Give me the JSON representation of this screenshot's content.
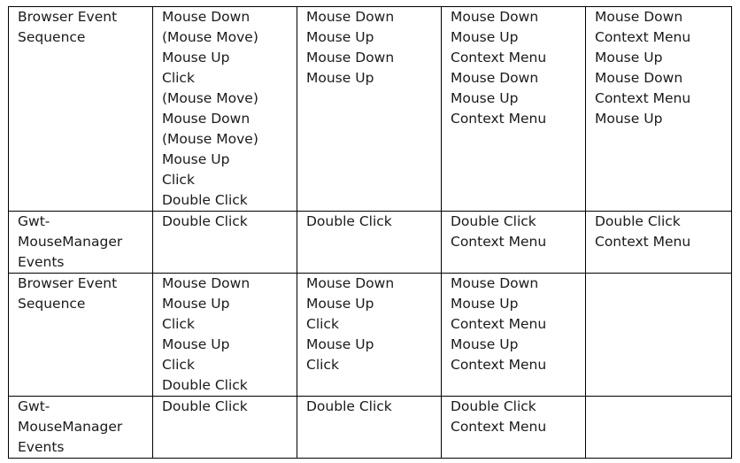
{
  "table": {
    "rows": [
      [
        [
          "Browser Event",
          "Sequence"
        ],
        [
          "Mouse Down",
          "(Mouse Move)",
          "Mouse Up",
          "Click",
          "(Mouse Move)",
          "Mouse Down",
          "(Mouse Move)",
          "Mouse Up",
          "Click",
          "Double Click"
        ],
        [
          "Mouse Down",
          "Mouse Up",
          "Mouse Down",
          "Mouse Up"
        ],
        [
          "Mouse Down",
          "Mouse Up",
          "Context Menu",
          "Mouse Down",
          "Mouse Up",
          "Context Menu"
        ],
        [
          "Mouse Down",
          "Context Menu",
          "Mouse Up",
          "Mouse Down",
          "Context Menu",
          "Mouse Up"
        ]
      ],
      [
        [
          "Gwt-",
          "MouseManager",
          "Events"
        ],
        [
          "Double Click"
        ],
        [
          "Double Click"
        ],
        [
          "Double Click",
          "Context Menu"
        ],
        [
          "Double Click",
          "Context Menu"
        ]
      ],
      [
        [
          "Browser Event",
          "Sequence"
        ],
        [
          "Mouse Down",
          "Mouse Up",
          "Click",
          "Mouse Up",
          "Click",
          "Double Click"
        ],
        [
          "Mouse Down",
          "Mouse Up",
          "Click",
          "Mouse Up",
          "Click"
        ],
        [
          "Mouse Down",
          "Mouse Up",
          "Context Menu",
          "Mouse Up",
          "Context Menu"
        ],
        []
      ],
      [
        [
          "Gwt-",
          "MouseManager",
          "Events"
        ],
        [
          "Double Click"
        ],
        [
          "Double Click"
        ],
        [
          "Double Click",
          "Context Menu"
        ],
        []
      ]
    ]
  }
}
